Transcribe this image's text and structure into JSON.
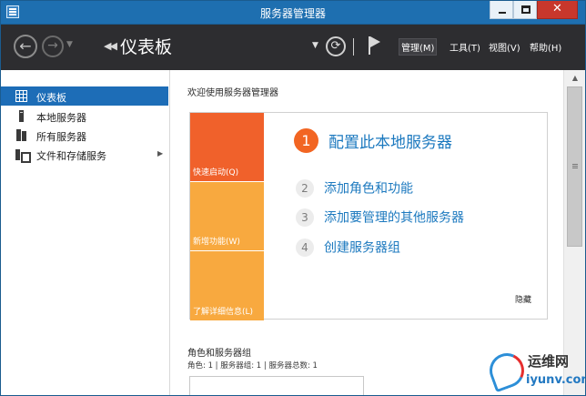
{
  "window": {
    "title": "服务器管理器",
    "controls": {
      "close": "✕"
    }
  },
  "commandbar": {
    "page_title": "仪表板",
    "menus": {
      "manage": "管理(M)",
      "tools": "工具(T)",
      "view": "视图(V)",
      "help": "帮助(H)"
    }
  },
  "sidebar": {
    "items": [
      {
        "label": "仪表板",
        "icon": "dashboard-icon",
        "selected": true
      },
      {
        "label": "本地服务器",
        "icon": "server-icon"
      },
      {
        "label": "所有服务器",
        "icon": "servers-icon"
      },
      {
        "label": "文件和存储服务",
        "icon": "storage-icon",
        "has_children": true
      }
    ]
  },
  "main": {
    "welcome_heading": "欢迎使用服务器管理器",
    "tiles": {
      "quickstart": "快速启动(Q)",
      "whatsnew": "新增功能(W)",
      "learnmore": "了解详细信息(L)"
    },
    "steps": [
      {
        "num": "1",
        "text": "配置此本地服务器"
      },
      {
        "num": "2",
        "text": "添加角色和功能"
      },
      {
        "num": "3",
        "text": "添加要管理的其他服务器"
      },
      {
        "num": "4",
        "text": "创建服务器组"
      }
    ],
    "hide_label": "隐藏",
    "roles_heading": "角色和服务器组",
    "roles_summary": "角色: 1 | 服务器组: 1 | 服务器总数: 1"
  },
  "watermark": {
    "title": "运维网",
    "url": "iyunv.com"
  },
  "colors": {
    "titlebar": "#1e6fb0",
    "commandbar": "#2d2d30",
    "selected": "#1d6db7",
    "quickstart_tile": "#f0612b",
    "tile": "#f8a93f",
    "link": "#1c79bf",
    "step1_badge": "#f26522"
  }
}
